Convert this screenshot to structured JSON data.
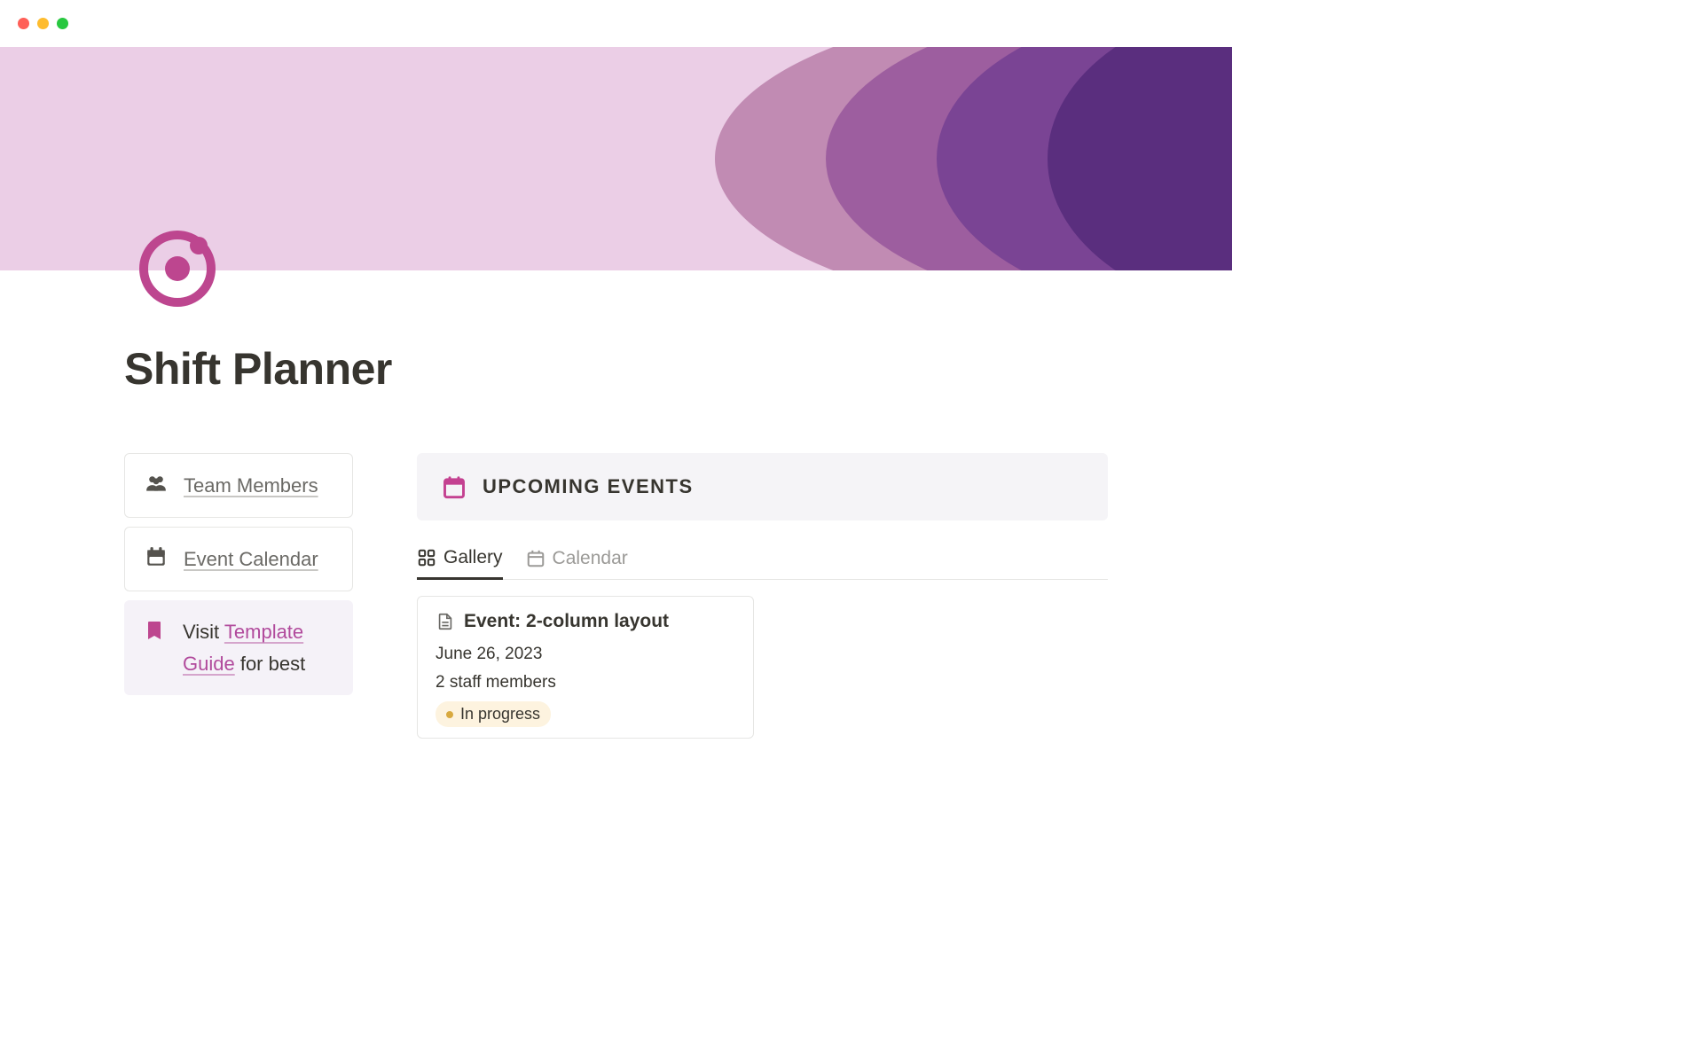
{
  "page": {
    "title": "Shift Planner"
  },
  "sidebar": {
    "team_members": "Team Members",
    "event_calendar": "Event Calendar",
    "callout_prefix": "Visit ",
    "callout_link": "Template Guide",
    "callout_suffix": " for best"
  },
  "section": {
    "title": "UPCOMING EVENTS"
  },
  "tabs": {
    "gallery": "Gallery",
    "calendar": "Calendar"
  },
  "card": {
    "title": "Event: 2-column layout",
    "date": "June 26, 2023",
    "staff": "2 staff members",
    "status": "In progress"
  }
}
